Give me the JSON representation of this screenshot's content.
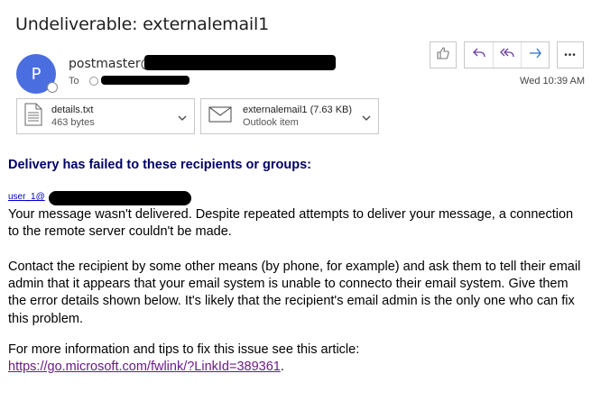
{
  "email": {
    "subject": "Undeliverable: externalemail1",
    "avatar_initial": "P",
    "sender_prefix": "postmaster@",
    "to_label": "To",
    "date": "Wed 10:39 AM"
  },
  "actions": {
    "like_icon": "thumbs-up-icon",
    "reply_icon": "reply-icon",
    "reply_all_icon": "reply-all-icon",
    "forward_icon": "forward-icon",
    "more_icon": "more-icon",
    "more_label": "•••"
  },
  "attachments": [
    {
      "name": "details.txt",
      "meta": "463 bytes",
      "icon": "text-file-icon"
    },
    {
      "name": "externalemail1 (7.63 KB)",
      "meta": "Outlook item",
      "icon": "envelope-icon"
    }
  ],
  "body": {
    "heading": "Delivery has failed to these recipients or groups:",
    "recipient_prefix": "user_1@",
    "para1": "Your message wasn't delivered. Despite repeated attempts to deliver your message, a connection to the remote server couldn't be made.",
    "para2": "Contact the recipient by some other means (by phone, for example) and ask them to tell their email admin that it appears that your email system is unable to connecto their email system. Give them the error details shown below. It's likely that the recipient's email admin is the only one who can fix this problem.",
    "para3_text": "For more information and tips to fix this issue see this article:",
    "link": "https://go.microsoft.com/fwlink/?LinkId=389361",
    "link_suffix": "."
  },
  "colors": {
    "avatar": "#4a6ee0",
    "accent": "#6a3fa0",
    "heading": "#000068",
    "link": "#6b1a8a"
  }
}
